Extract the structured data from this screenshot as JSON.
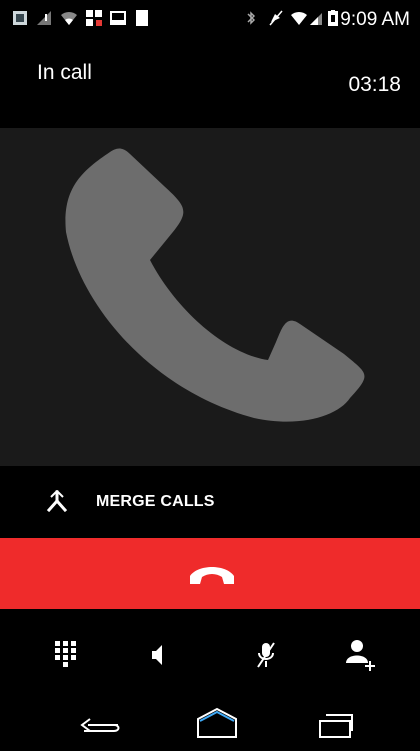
{
  "status_bar": {
    "time": "9:09 AM",
    "left_icons": [
      "app-notification-icon",
      "signal-off-icon",
      "wifi-icon",
      "qr-icon",
      "image-icon",
      "sd-icon"
    ],
    "right_icons": [
      "bluetooth-icon",
      "mute-icon",
      "wifi-icon",
      "signal-icon",
      "battery-icon"
    ]
  },
  "call": {
    "status_label": "In call",
    "duration": "03:18"
  },
  "merge": {
    "label": "MERGE CALLS"
  },
  "colors": {
    "end_call": "#ef2b2b",
    "main_bg": "#1a1a1a",
    "handset": "#6d6d6d"
  },
  "controls": [
    "dialpad-icon",
    "speaker-icon",
    "mute-mic-icon",
    "add-call-icon"
  ],
  "nav": [
    "back-icon",
    "home-icon",
    "recents-icon"
  ]
}
